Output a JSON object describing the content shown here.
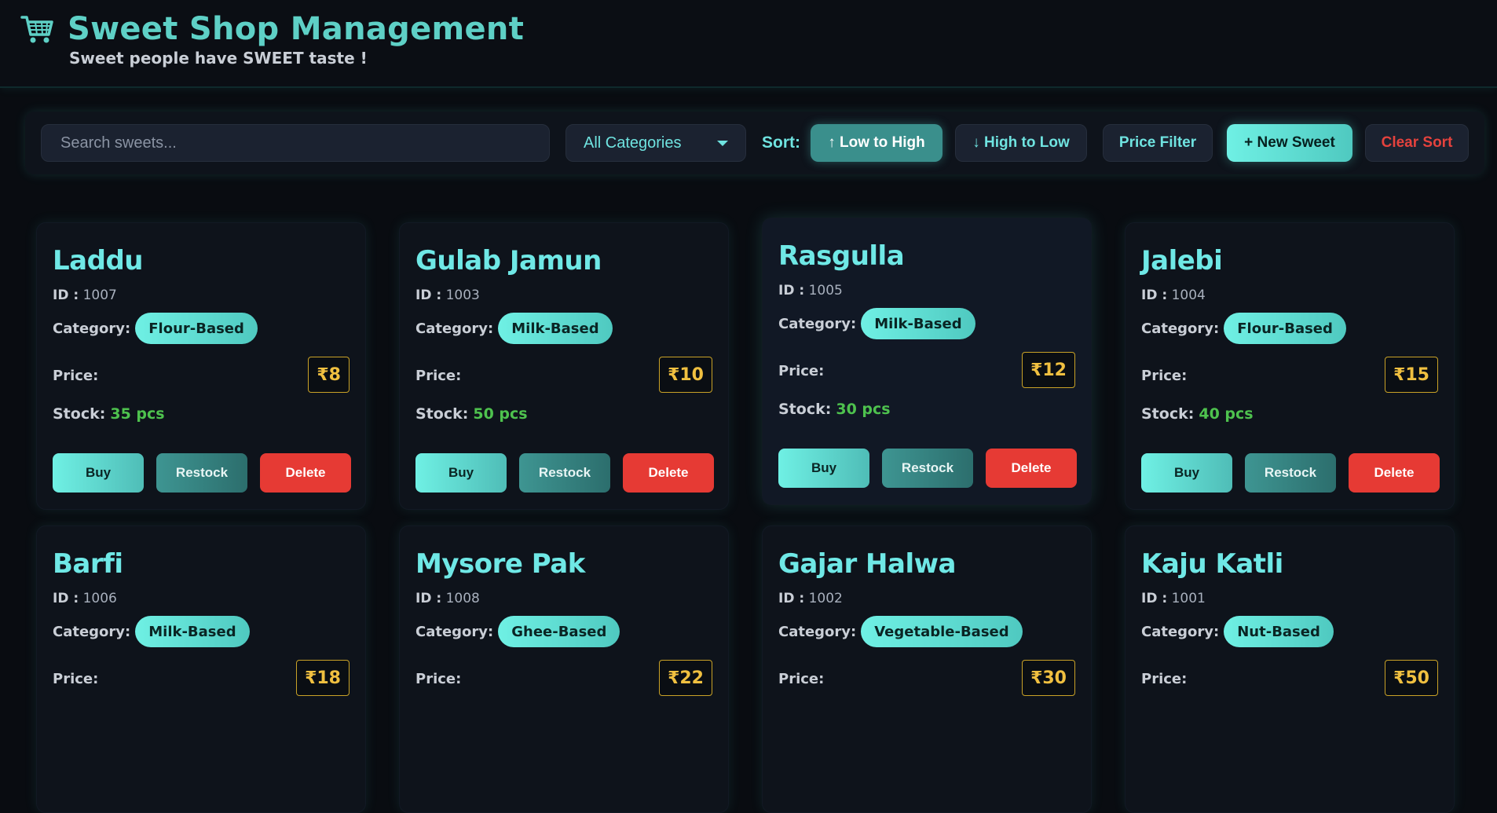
{
  "header": {
    "title": "Sweet Shop Management",
    "subtitle": "Sweet people have SWEET taste !",
    "logo_icon": "shopping-cart-icon"
  },
  "toolbar": {
    "search_placeholder": "Search sweets...",
    "category_selected": "All Categories",
    "sort_label": "Sort:",
    "sort_low_label": "↑ Low to High",
    "sort_high_label": "↓ High to Low",
    "price_filter_label": "Price Filter",
    "new_sweet_label": "+ New Sweet",
    "clear_sort_label": "Clear Sort"
  },
  "labels": {
    "id": "ID :",
    "category": "Category:",
    "price": "Price:",
    "stock": "Stock:",
    "buy": "Buy",
    "restock": "Restock",
    "delete": "Delete"
  },
  "sweets": [
    {
      "name": "Laddu",
      "id": "1007",
      "category": "Flour-Based",
      "price": "₹8",
      "stock": "35 pcs"
    },
    {
      "name": "Gulab Jamun",
      "id": "1003",
      "category": "Milk-Based",
      "price": "₹10",
      "stock": "50 pcs"
    },
    {
      "name": "Rasgulla",
      "id": "1005",
      "category": "Milk-Based",
      "price": "₹12",
      "stock": "30 pcs"
    },
    {
      "name": "Jalebi",
      "id": "1004",
      "category": "Flour-Based",
      "price": "₹15",
      "stock": "40 pcs"
    },
    {
      "name": "Barfi",
      "id": "1006",
      "category": "Milk-Based",
      "price": "₹18",
      "stock": ""
    },
    {
      "name": "Mysore Pak",
      "id": "1008",
      "category": "Ghee-Based",
      "price": "₹22",
      "stock": ""
    },
    {
      "name": "Gajar Halwa",
      "id": "1002",
      "category": "Vegetable-Based",
      "price": "₹30",
      "stock": ""
    },
    {
      "name": "Kaju Katli",
      "id": "1001",
      "category": "Nut-Based",
      "price": "₹50",
      "stock": ""
    }
  ],
  "colors": {
    "accent": "#6fe8e6",
    "price_gold": "#f0c040",
    "stock_green": "#4ec24e",
    "danger": "#e63a34",
    "background": "#090c11"
  }
}
